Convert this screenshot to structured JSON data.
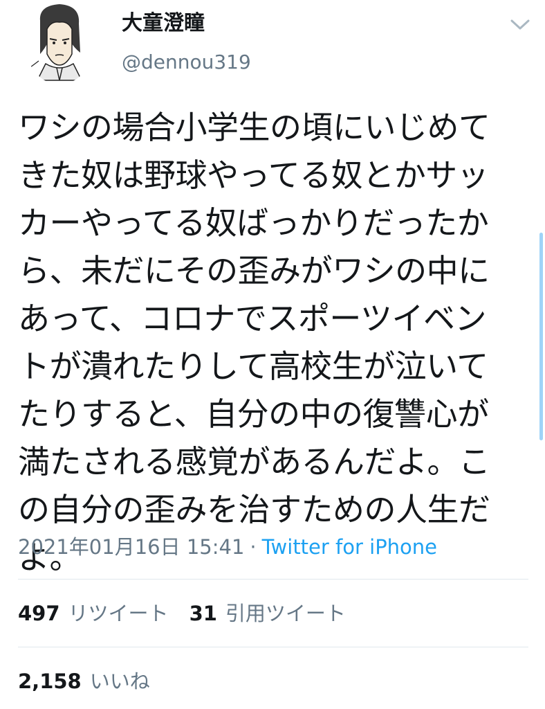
{
  "author": {
    "display_name": "大童澄瞳",
    "handle": "@dennou319",
    "avatar_icon": "cartoon-portrait-avatar"
  },
  "menu_icon": "chevron-down-icon",
  "tweet": {
    "text": "ワシの場合小学生の頃にいじめて\nきた奴は野球やってる奴とかサッ\nカーやってる奴ばっかりだったか\nら、未だにその歪みがワシの中に\nあって、コロナでスポーツイベン\nトが潰れたりして高校生が泣いて\nたりすると、自分の中の復讐心が\n満たされる感覚があるんだよ。こ\nの自分の歪みを治すための人生だ\nよ。",
    "timestamp": "2021年01月16日 15:41",
    "separator": "·",
    "source": "Twitter for iPhone"
  },
  "stats": {
    "retweets_count": "497",
    "retweets_label": "リツイート",
    "quotes_count": "31",
    "quotes_label": "引用ツイート",
    "likes_count": "2,158",
    "likes_label": "いいね"
  },
  "colors": {
    "text": "#14171a",
    "secondary": "#657786",
    "link": "#1da1f2",
    "divider": "#e1e8ed"
  }
}
